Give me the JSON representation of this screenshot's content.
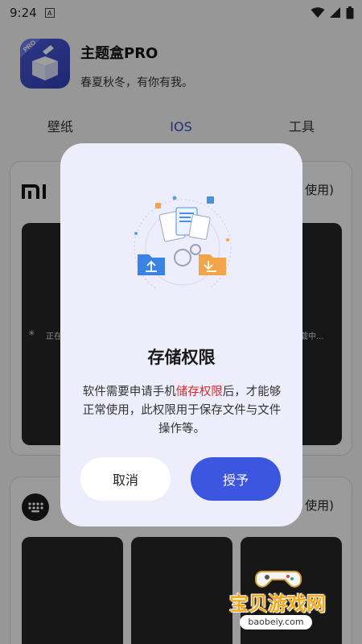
{
  "status_bar": {
    "time": "9:24",
    "a_badge": "A"
  },
  "app": {
    "title": "主题盒PRO",
    "subtitle": "春夏秋冬，有你有我。",
    "icon_badge": "PRO"
  },
  "tabs": [
    {
      "label": "壁纸",
      "active": false
    },
    {
      "label": "IOS",
      "active": true
    },
    {
      "label": "工具",
      "active": false
    }
  ],
  "cards": [
    {
      "logo": "mi",
      "use_label": "使用)",
      "loading_left": "正在",
      "loading_right": "加载中..."
    },
    {
      "logo": "dots-icon",
      "use_label": "使用)"
    }
  ],
  "dialog": {
    "title": "存储权限",
    "body_pre": "软件需要申请手机",
    "body_highlight": "储存权限",
    "body_post": "后，才能够正常使用，此权限用于保存文件与文件操作等。",
    "cancel_label": "取消",
    "grant_label": "授予",
    "highlight_color": "#e02a2a",
    "accent_color": "#3d56e0"
  },
  "watermark": {
    "text": "宝贝游戏网",
    "url": "baobeiy.com"
  }
}
